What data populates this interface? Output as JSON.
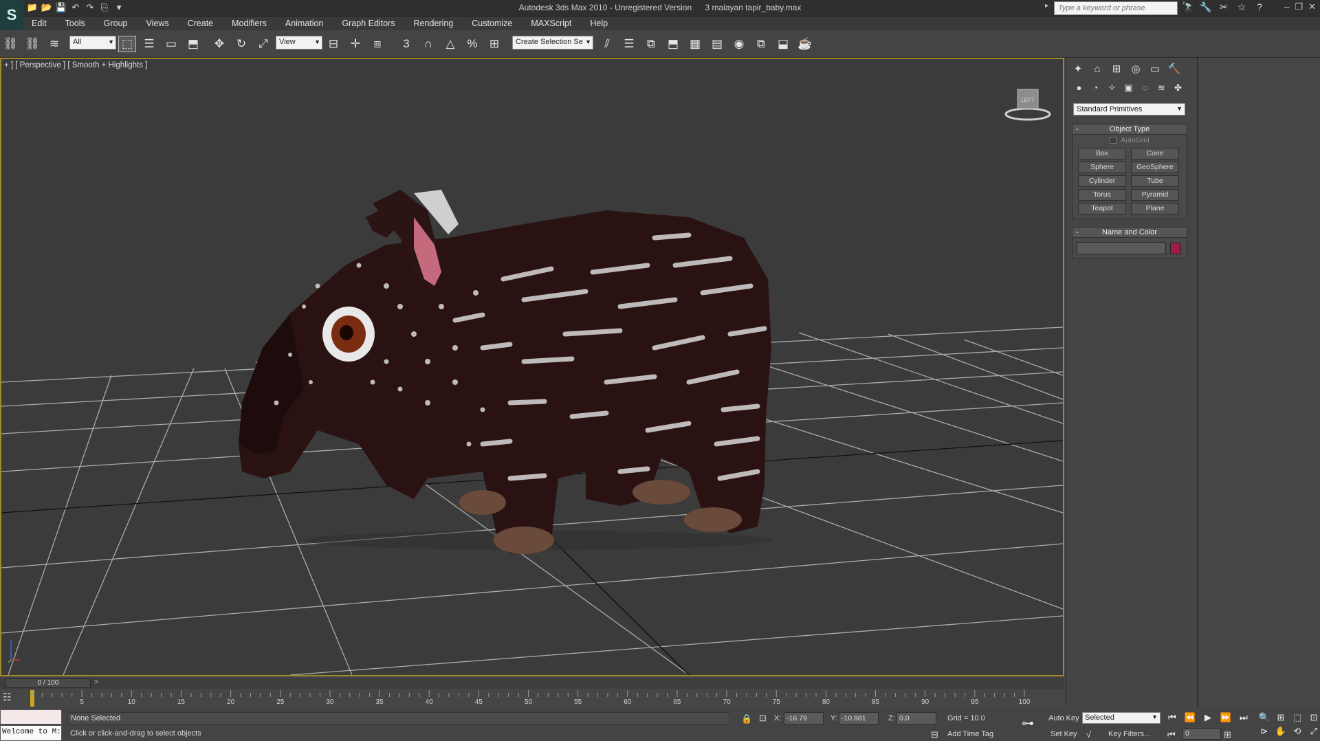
{
  "titlebar": {
    "app_logo": "S",
    "title": "Autodesk 3ds Max  2010   -  Unregistered Version",
    "filename": "3 malayan tapir_baby.max",
    "search_placeholder": "Type a keyword or phrase",
    "qat_icons": [
      "📁",
      "📂",
      "💾",
      "↶",
      "↷",
      "⎘",
      "▾"
    ],
    "search_tools": [
      "🔭",
      "🔧",
      "✂",
      "☆",
      "?"
    ],
    "window_buttons": [
      "–",
      "❐",
      "✕"
    ]
  },
  "menu": {
    "items": [
      "Edit",
      "Tools",
      "Group",
      "Views",
      "Create",
      "Modifiers",
      "Animation",
      "Graph Editors",
      "Rendering",
      "Customize",
      "MAXScript",
      "Help"
    ]
  },
  "toolbar": {
    "selection_filter": "All",
    "ref_coord": "View",
    "named_selection": "Create Selection Se",
    "snap_label": "3",
    "icons_left": [
      "⛓",
      "⛓",
      "≋"
    ],
    "icons_select": [
      "⬚",
      "☰",
      "▭",
      "⬒"
    ],
    "icons_transform": [
      "✥",
      "↻",
      "⤢"
    ],
    "icons_pivot": [
      "⊟",
      "✛",
      "⧈"
    ],
    "icons_snaps": [
      "∩",
      "△",
      "%",
      "⊞",
      "✎"
    ],
    "icons_right": [
      "⫽",
      "☰",
      "⧉",
      "⬒",
      "▦",
      "▤",
      "◉",
      "⧉",
      "⬓",
      "☕"
    ]
  },
  "viewport": {
    "label": "+ ] [ Perspective ] [ Smooth + Highlights ]",
    "viewcube_label": "LEFT",
    "accent_border": "#a08a2a",
    "grid_color": "#bfbfbf"
  },
  "command_panel": {
    "tabs": [
      "✦",
      "⌂",
      "⊞",
      "◎",
      "▭",
      "🔨"
    ],
    "subtabs": [
      "●",
      "◔",
      "✧",
      "▣",
      "◌",
      "≋",
      "✤"
    ],
    "category": "Standard Primitives",
    "object_type": {
      "title": "Object Type",
      "autogrid": "AutoGrid",
      "buttons": [
        "Box",
        "Cone",
        "Sphere",
        "GeoSphere",
        "Cylinder",
        "Tube",
        "Torus",
        "Pyramid",
        "Teapot",
        "Plane"
      ]
    },
    "name_and_color": {
      "title": "Name and Color",
      "name_value": "",
      "color": "#a11b49"
    }
  },
  "timeline": {
    "slider_label": "0 / 100",
    "next_arrow": ">",
    "current_frame": 0,
    "ticks": [
      "5",
      "10",
      "15",
      "20",
      "25",
      "30",
      "35",
      "40",
      "45",
      "50",
      "55",
      "60",
      "65",
      "70",
      "75",
      "80",
      "85",
      "90",
      "95",
      "100"
    ]
  },
  "status": {
    "listener_text": "Welcome to M:",
    "selection_status": "None Selected",
    "prompt": "Click or click-and-drag to select objects",
    "x_label": "X:",
    "x_value": "-16.79",
    "y_label": "Y:",
    "y_value": "-10.881",
    "z_label": "Z:",
    "z_value": "0.0",
    "grid": "Grid = 10.0",
    "add_time_tag": "Add Time Tag",
    "auto_key": "Auto Key",
    "set_key": "Set Key",
    "selected_dropdown": "Selected",
    "key_filters": "Key Filters...",
    "frame_value": "0",
    "playback_icons": [
      "⏮",
      "⏪",
      "▶",
      "⏩",
      "⏭"
    ],
    "nav_icons": [
      "🔍",
      "⊞",
      "⬚",
      "⊡",
      "⊳",
      "✋",
      "⟲",
      "⤢"
    ]
  }
}
